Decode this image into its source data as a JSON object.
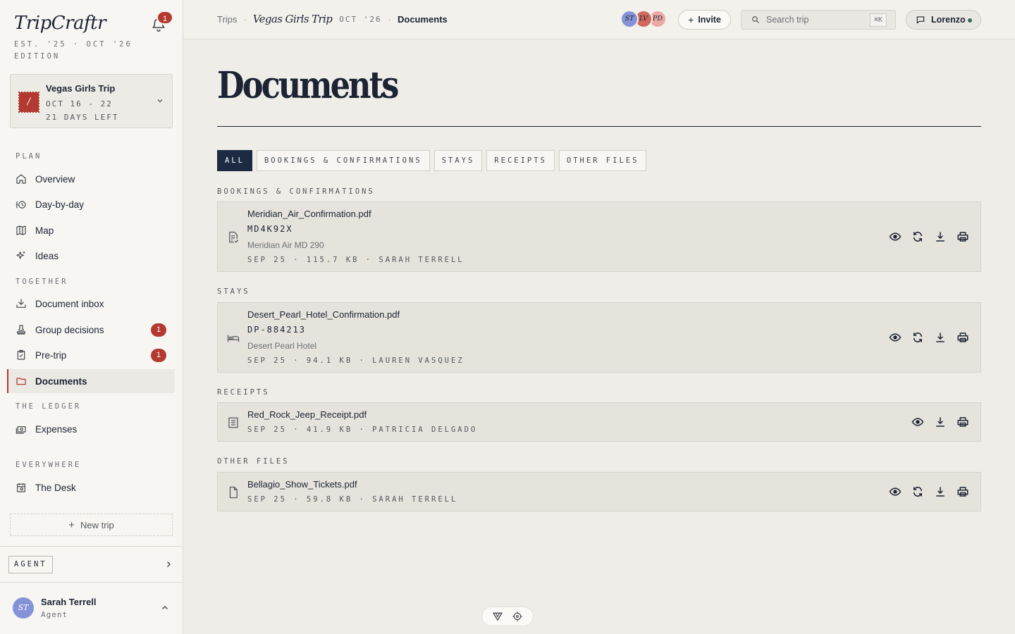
{
  "app": {
    "brand": "TripCraftr",
    "edition": "EST. '25 · OCT '26 EDITION",
    "notifications_count": "1"
  },
  "trip": {
    "stamp": "/",
    "name": "Vegas Girls Trip",
    "dates": "OCT 16 - 22",
    "days_left": "21 DAYS LEFT"
  },
  "sidebar": {
    "sections": {
      "plan": "PLAN",
      "together": "TOGETHER",
      "ledger": "THE LEDGER",
      "everywhere": "EVERYWHERE"
    },
    "items": [
      {
        "label": "Overview",
        "icon": "home-icon"
      },
      {
        "label": "Day-by-day",
        "icon": "calendar-clock-icon"
      },
      {
        "label": "Map",
        "icon": "map-icon"
      },
      {
        "label": "Ideas",
        "icon": "sparkles-icon"
      },
      {
        "label": "Document inbox",
        "icon": "inbox-download-icon"
      },
      {
        "label": "Group decisions",
        "icon": "vote-stamp-icon",
        "badge": "1"
      },
      {
        "label": "Pre-trip",
        "icon": "clipboard-check-icon",
        "badge": "1"
      },
      {
        "label": "Documents",
        "icon": "folder-icon",
        "active": true
      },
      {
        "label": "Expenses",
        "icon": "money-icon"
      },
      {
        "label": "The Desk",
        "icon": "desk-calendar-icon"
      }
    ],
    "new_trip": "New trip",
    "agent_label": "AGENT",
    "user": {
      "initials": "ST",
      "name": "Sarah Terrell",
      "role": "Agent"
    }
  },
  "topbar": {
    "breadcrumb": {
      "root": "Trips",
      "trip": "Vegas Girls Trip",
      "date": "OCT '26",
      "current": "Documents"
    },
    "members": [
      {
        "initials": "ST",
        "color": "#8593d6"
      },
      {
        "initials": "LV",
        "color": "#d0685c"
      },
      {
        "initials": "PD",
        "color": "#eba9a6"
      }
    ],
    "invite_label": "Invite",
    "search_placeholder": "Search trip",
    "search_shortcut": "⌘K",
    "user_button": "Lorenzo"
  },
  "main": {
    "title": "Documents",
    "tabs": [
      "ALL",
      "BOOKINGS & CONFIRMATIONS",
      "STAYS",
      "RECEIPTS",
      "OTHER FILES"
    ],
    "active_tab": "ALL",
    "groups": [
      {
        "label": "BOOKINGS & CONFIRMATIONS",
        "docs": [
          {
            "file": "Meridian_Air_Confirmation.pdf",
            "code": "MD4K92X",
            "subtitle": "Meridian Air MD 290",
            "meta": "SEP 25 · 115.7 KB · SARAH TERRELL",
            "icon": "file-check-icon",
            "actions": [
              "view",
              "replace",
              "download",
              "print"
            ]
          }
        ]
      },
      {
        "label": "STAYS",
        "docs": [
          {
            "file": "Desert_Pearl_Hotel_Confirmation.pdf",
            "code": "DP-884213",
            "subtitle": "Desert Pearl Hotel",
            "meta": "SEP 25 · 94.1 KB · LAUREN VASQUEZ",
            "icon": "bed-icon",
            "actions": [
              "view",
              "replace",
              "download",
              "print"
            ]
          }
        ]
      },
      {
        "label": "RECEIPTS",
        "docs": [
          {
            "file": "Red_Rock_Jeep_Receipt.pdf",
            "meta": "SEP 25 · 41.9 KB · PATRICIA DELGADO",
            "icon": "receipt-icon",
            "actions": [
              "view",
              "download",
              "print"
            ]
          }
        ]
      },
      {
        "label": "OTHER FILES",
        "docs": [
          {
            "file": "Bellagio_Show_Tickets.pdf",
            "meta": "SEP 25 · 59.8 KB · SARAH TERRELL",
            "icon": "file-icon",
            "actions": [
              "view",
              "replace",
              "download",
              "print"
            ]
          }
        ]
      }
    ]
  },
  "colors": {
    "accent": "#b23a30",
    "ink": "#1c2333",
    "tab_active": "#1c2a42",
    "background": "#efede7"
  }
}
